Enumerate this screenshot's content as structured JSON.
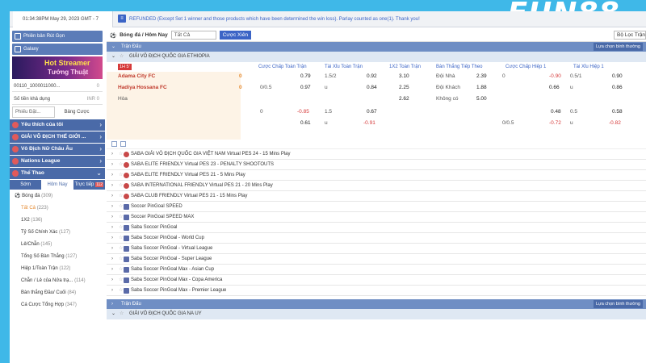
{
  "topbar": {
    "clock": "01:34:38PM May 29, 2023 GMT - 7",
    "notice": "REFUNDED (Except Set 1 winner and those products which have been determined the win loss). Parlay counted as one(1). Thank you!"
  },
  "logo": "FUN88",
  "sidebar": {
    "version_btn": "Phiên bản Rút Gọn",
    "galaxy_btn": "Galaxy",
    "banner_line1": "Hot Streamer",
    "banner_line2": "Tướng Thuật",
    "account": "00110_1000011000...",
    "account_extra": "0",
    "balance_label": "Số tiền khả dụng",
    "balance_value": "INR 0",
    "bet_select": "Phiếu Đặt...",
    "bet_list": "Bảng Cược",
    "cat_fav": "Yêu thích của tôi",
    "cat_wc": "GIẢI VÔ ĐỊCH THẾ GIỚI ...",
    "cat_women": "Vô Địch Nữ Châu Âu",
    "cat_nations": "Nations League",
    "cat_sports": "Thể Thao",
    "tab_early": "Sớm",
    "tab_today": "Hôm Nay",
    "tab_live": "Trực tiếp",
    "live_count": "112",
    "sport": "Bóng đá",
    "sport_count": "(309)",
    "items": [
      {
        "label": "Tất Cả",
        "count": "(223)"
      },
      {
        "label": "1X2",
        "count": "(136)"
      },
      {
        "label": "Tỷ Số Chính Xác",
        "count": "(127)"
      },
      {
        "label": "Lẻ/Chẵn",
        "count": "(145)"
      },
      {
        "label": "Tổng Số Bàn Thắng",
        "count": "(127)"
      },
      {
        "label": "Hiệp 1/Toàn Trận",
        "count": "(122)"
      },
      {
        "label": "Chẵn / Lẻ của Nửa trạ...",
        "count": "(114)"
      },
      {
        "label": "Bàn thắng Đầu/ Cuối",
        "count": "(84)"
      },
      {
        "label": "Cá Cược Tổng Hợp",
        "count": "(347)"
      }
    ]
  },
  "filter": {
    "sport_label": "Bóng đá / Hôm Nay",
    "select_all": "Tất Cả",
    "parlay_btn": "Cược Xiên",
    "filter_right": "Bộ Lọc Trận Đấu"
  },
  "section": {
    "title": "Trận Đấu",
    "sort": "Lựa chọn bình thường"
  },
  "league_main": "GIẢI VÔ ĐỊCH QUỐC GIA ETHIOPIA",
  "live_badge": "1H 5'",
  "odds_headers": [
    "Cược Chấp Toàn Trận",
    "Tài Xỉu Toàn Trận",
    "1X2 Toàn Trận",
    "Bàn Thắng Tiếp Theo",
    "Cược Chấp Hiệp 1",
    "Tài Xỉu Hiệp 1"
  ],
  "match": {
    "home": "Adama City FC",
    "away": "Hadiya Hossana FC",
    "draw": "Hòa",
    "home_score": "0",
    "away_score": "0",
    "r1": {
      "hdp_line": "",
      "hdp_odd": "0.79",
      "ou_line": "1.5/2",
      "ou_odd": "0.92",
      "x12": "3.10",
      "ng_label": "Đội Nhà",
      "ng_odd": "2.39",
      "h1_line": "0",
      "h1_odd": "-0.90",
      "h1ou_line": "0.5/1",
      "h1ou_odd": "0.90"
    },
    "r2": {
      "hdp_line": "0/0.5",
      "hdp_odd": "0.97",
      "ou_line": "u",
      "ou_odd": "0.84",
      "x12": "2.25",
      "ng_label": "Đội Khách",
      "ng_odd": "1.88",
      "h1_line": "",
      "h1_odd": "0.66",
      "h1ou_line": "u",
      "h1ou_odd": "0.86"
    },
    "r3": {
      "x12": "2.62",
      "ng_label": "Không có",
      "ng_odd": "5.00"
    },
    "r4": {
      "hdp_line": "0",
      "hdp_odd": "-0.85",
      "ou_line": "1.5",
      "ou_odd": "0.67",
      "h1_odd": "0.48",
      "h1ou_line": "0.5",
      "h1ou_odd": "0.58"
    },
    "r5": {
      "hdp_odd": "0.61",
      "ou_line": "u",
      "ou_odd": "-0.91",
      "h1_line": "0/0.5",
      "h1_odd": "-0.72",
      "h1ou_line": "u",
      "h1ou_odd": "-0.82"
    }
  },
  "leagues": [
    "SABA GIẢI VÔ ĐỊCH QUỐC GIA VIỆT NAM Virtual PES 24 - 15 Mins Play",
    "SABA ELITE FRIENDLY Virtual PES 23 - PENALTY SHOOTOUTS",
    "SABA ELITE FRIENDLY Virtual PES 21 - 5 Mins Play",
    "SABA INTERNATIONAL FRIENDLY Virtual PES 21 - 20 Mins Play",
    "SABA CLUB FRIENDLY Virtual PES 21 - 15 Mins Play",
    "Soccer PinGoal SPEED",
    "Soccer PinGoal SPEED MAX",
    "Saba Soccer PinGoal",
    "Saba Soccer PinGoal - World Cup",
    "Saba Soccer PinGoal - Virtual League",
    "Saba Soccer PinGoal - Super League",
    "Saba Soccer PinGoal Max - Asian Cup",
    "Saba Soccer PinGoal Max - Copa America",
    "Saba Soccer PinGoal Max - Premier League"
  ],
  "section2": {
    "title": "Trận Đấu",
    "sort": "Lựa chọn bình thường"
  },
  "league_bottom": "GIẢI VÔ ĐỊCH QUỐC GIA NA UY"
}
